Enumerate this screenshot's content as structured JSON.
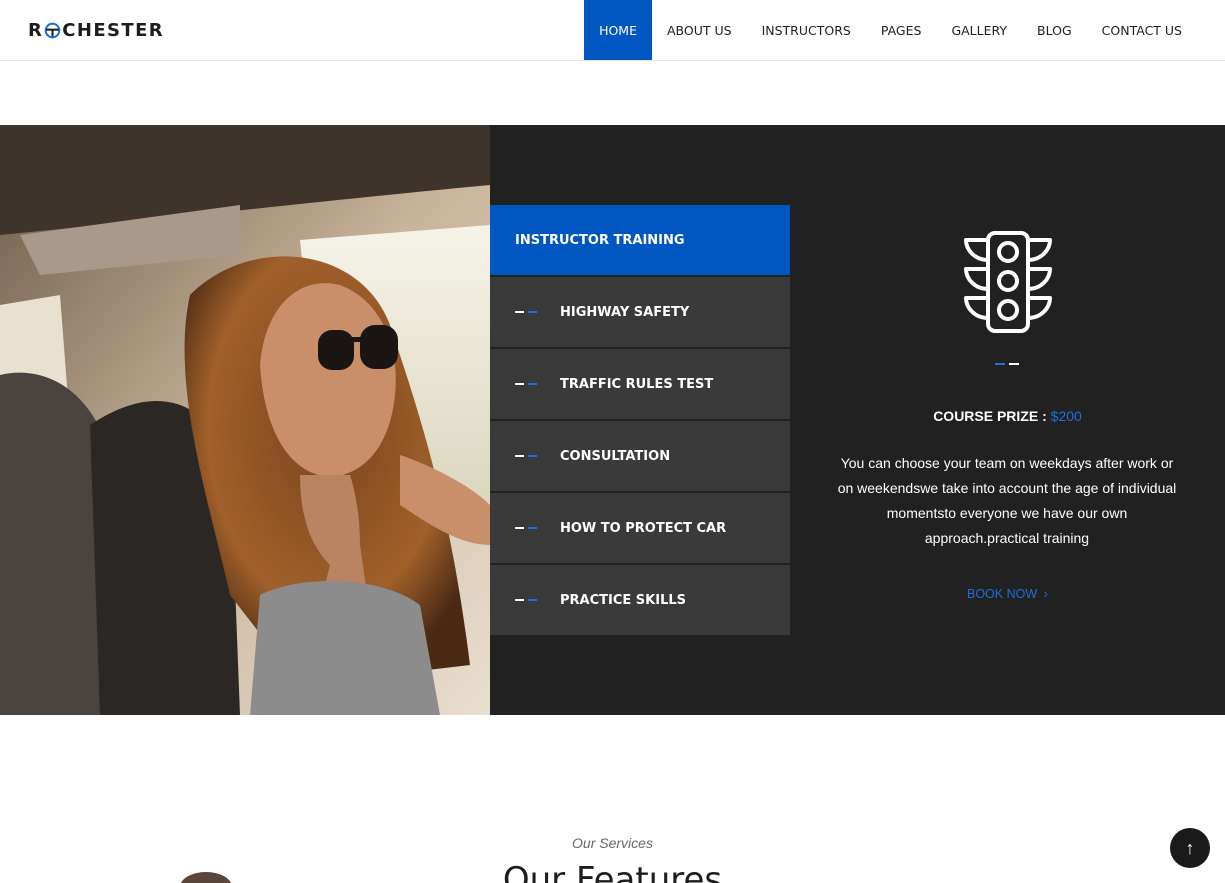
{
  "header": {
    "logo_text_left": "R",
    "logo_text_right": "CHESTER",
    "nav": [
      {
        "label": "HOME",
        "active": true
      },
      {
        "label": "ABOUT US"
      },
      {
        "label": "INSTRUCTORS"
      },
      {
        "label": "PAGES"
      },
      {
        "label": "GALLERY"
      },
      {
        "label": "BLOG"
      },
      {
        "label": "CONTACT US"
      }
    ]
  },
  "tabs": [
    {
      "label": "INSTRUCTOR TRAINING",
      "active": true
    },
    {
      "label": "HIGHWAY SAFETY"
    },
    {
      "label": "TRAFFIC RULES TEST"
    },
    {
      "label": "CONSULTATION"
    },
    {
      "label": "HOW TO PROTECT CAR"
    },
    {
      "label": "PRACTICE SKILLS"
    }
  ],
  "detail": {
    "icon": "traffic-light-icon",
    "prize_label": "COURSE PRIZE : ",
    "prize_value": "$200",
    "description": "You can choose your team on weekdays after work or on weekendswe take into account the age of individual momentsto everyone we have our own approach.practical training",
    "book_label": "BOOK NOW",
    "book_icon": "chevron-right-icon"
  },
  "services": {
    "subtitle": "Our Services",
    "title": "Our Features"
  },
  "scroll_top_icon": "arrow-up-icon",
  "colors": {
    "accent": "#0057c2",
    "dark": "#212121",
    "tab": "#3a3a3a"
  }
}
